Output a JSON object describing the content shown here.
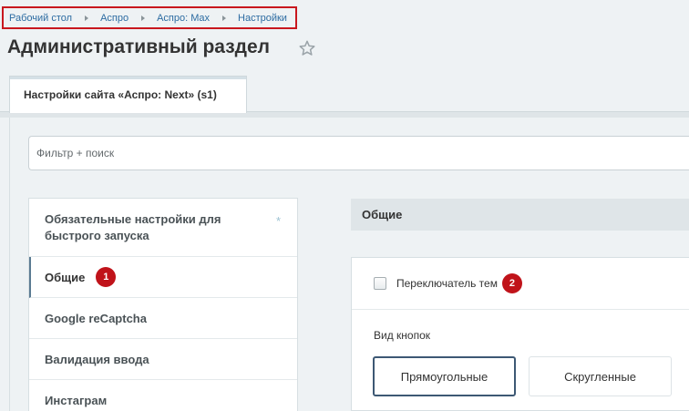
{
  "breadcrumb": [
    "Рабочий стол",
    "Аспро",
    "Аспро: Max",
    "Настройки"
  ],
  "page_title": "Административный раздел",
  "tab": {
    "label": "Настройки сайта «Аспро: Next» (s1)"
  },
  "filter": {
    "placeholder": "Фильтр + поиск"
  },
  "menu": [
    {
      "label": "Обязательные настройки для быстрого запуска",
      "favorite_mark": "*"
    },
    {
      "label": "Общие",
      "badge": "1"
    },
    {
      "label": "Google reCaptcha"
    },
    {
      "label": "Валидация ввода"
    },
    {
      "label": "Инстаграм"
    }
  ],
  "section": {
    "title": "Общие"
  },
  "theme_switch": {
    "label": "Переключатель тем",
    "checked": false,
    "badge": "2"
  },
  "button_style": {
    "label": "Вид кнопок",
    "options": [
      "Прямоугольные",
      "Скругленные"
    ],
    "selected": "Прямоугольные"
  },
  "colors": {
    "annotation": "#c0131a",
    "link": "#2d6ca2"
  }
}
